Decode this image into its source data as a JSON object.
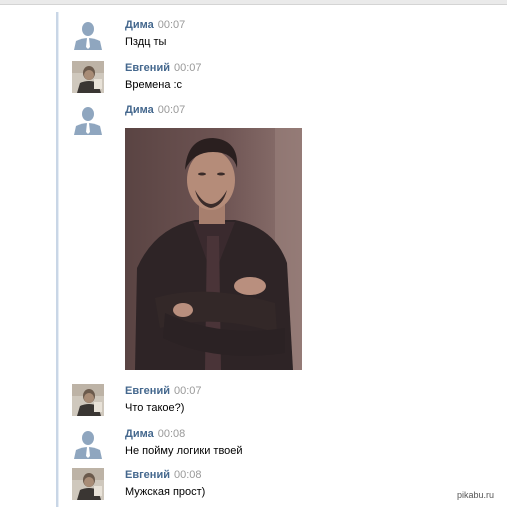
{
  "messages": [
    {
      "author": "Дима",
      "time": "00:07",
      "text": "Пздц ты",
      "avatar": "default-user-icon"
    },
    {
      "author": "Евгений",
      "time": "00:07",
      "text": "Времена :с",
      "avatar": "user-photo"
    },
    {
      "author": "Дима",
      "time": "00:07",
      "text": "",
      "avatar": "default-user-icon",
      "attachment": "photo-man-arms-crossed"
    },
    {
      "author": "Евгений",
      "time": "00:07",
      "text": "Что такое?)",
      "avatar": "user-photo"
    },
    {
      "author": "Дима",
      "time": "00:08",
      "text": "Не пойму логики твоей",
      "avatar": "default-user-icon"
    },
    {
      "author": "Евгений",
      "time": "00:08",
      "text": "Мужская прост)",
      "avatar": "user-photo"
    }
  ],
  "watermark": "pikabu.ru",
  "colors": {
    "author": "#45688e",
    "time": "#999999",
    "avatar_default": "#8fa6bf"
  }
}
